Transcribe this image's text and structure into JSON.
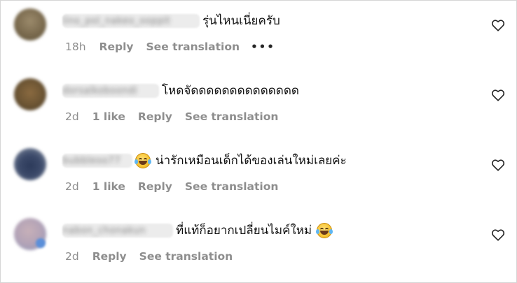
{
  "comments": [
    {
      "username": "lino_pol_nakeo_ooppit",
      "text": "รุ่นไหนเนี่ยครับ",
      "emoji_before": "",
      "emoji_after": "",
      "time": "18h",
      "likes": "",
      "reply_label": "Reply",
      "translate_label": "See translation",
      "more_label": "•••"
    },
    {
      "username": "dorsalkoboondi",
      "text": "โหดจัดดดดดดดดดดดดดด",
      "emoji_before": "",
      "emoji_after": "",
      "time": "2d",
      "likes": "1 like",
      "reply_label": "Reply",
      "translate_label": "See translation",
      "more_label": ""
    },
    {
      "username": "bubbleoo77",
      "text": "น่ารักเหมือนเด็กได้ของเล่นใหม่เลยค่ะ",
      "emoji_before": "face-with-tears-of-joy",
      "emoji_after": "",
      "time": "2d",
      "likes": "1 like",
      "reply_label": "Reply",
      "translate_label": "See translation",
      "more_label": ""
    },
    {
      "username": "nabon_chonakun",
      "text": "ที่แท้ก็อยากเปลี่ยนไมค์ใหม่",
      "emoji_before": "",
      "emoji_after": "face-with-tears-of-joy",
      "time": "2d",
      "likes": "",
      "reply_label": "Reply",
      "translate_label": "See translation",
      "more_label": ""
    }
  ],
  "icons": {
    "like": "heart-outline-icon",
    "emoji": "face-with-tears-of-joy"
  },
  "colors": {
    "meta_text": "#8e8e8e",
    "primary_text": "#111111",
    "background": "#ffffff"
  }
}
